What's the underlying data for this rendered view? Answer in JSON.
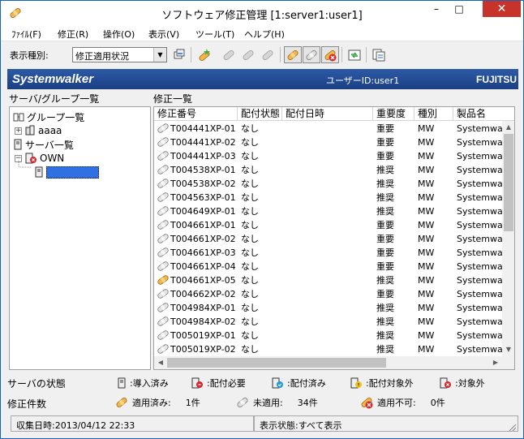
{
  "window": {
    "title": "ソフトウェア修正管理 [1:server1:user1]",
    "min": "–",
    "max": "□",
    "close": "✕"
  },
  "menu": [
    "ﾌｧｲﾙ(F)",
    "修正(R)",
    "操作(O)",
    "表示(V)",
    "ツール(T)",
    "ヘルプ(H)"
  ],
  "toolbar": {
    "label": "表示種別:",
    "select_value": "修正適用状況"
  },
  "banner": {
    "logo": "Systemwalker",
    "user": "ユーザーID:user1",
    "vendor": "FUJITSU"
  },
  "left_pane": {
    "heading": "サーバ/グループ一覧",
    "tree": [
      {
        "label": "グループ一覧"
      },
      {
        "label": "aaaa",
        "expander": "+"
      },
      {
        "label": "サーバ一覧"
      },
      {
        "label": "OWN",
        "expander": "−"
      },
      {
        "label": "███████"
      }
    ]
  },
  "right_pane": {
    "heading": "修正一覧",
    "columns": [
      "修正番号",
      "配付状態",
      "配付日時",
      "重要度",
      "種別",
      "製品名"
    ],
    "rows": [
      {
        "id": "T004441XP-01",
        "dist": "なし",
        "date": "",
        "severity": "重要",
        "kind": "MW",
        "product": "Systemwa",
        "status": "unapplied"
      },
      {
        "id": "T004441XP-02",
        "dist": "なし",
        "date": "",
        "severity": "重要",
        "kind": "MW",
        "product": "Systemwa",
        "status": "unapplied"
      },
      {
        "id": "T004441XP-03",
        "dist": "なし",
        "date": "",
        "severity": "重要",
        "kind": "MW",
        "product": "Systemwa",
        "status": "unapplied"
      },
      {
        "id": "T004538XP-01",
        "dist": "なし",
        "date": "",
        "severity": "推奨",
        "kind": "MW",
        "product": "Systemwa",
        "status": "unapplied"
      },
      {
        "id": "T004538XP-02",
        "dist": "なし",
        "date": "",
        "severity": "推奨",
        "kind": "MW",
        "product": "Systemwa",
        "status": "unapplied"
      },
      {
        "id": "T004563XP-01",
        "dist": "なし",
        "date": "",
        "severity": "推奨",
        "kind": "MW",
        "product": "Systemwa",
        "status": "unapplied"
      },
      {
        "id": "T004649XP-01",
        "dist": "なし",
        "date": "",
        "severity": "推奨",
        "kind": "MW",
        "product": "Systemwa",
        "status": "unapplied"
      },
      {
        "id": "T004661XP-01",
        "dist": "なし",
        "date": "",
        "severity": "重要",
        "kind": "MW",
        "product": "Systemwa",
        "status": "unapplied"
      },
      {
        "id": "T004661XP-02",
        "dist": "なし",
        "date": "",
        "severity": "重要",
        "kind": "MW",
        "product": "Systemwa",
        "status": "unapplied"
      },
      {
        "id": "T004661XP-03",
        "dist": "なし",
        "date": "",
        "severity": "重要",
        "kind": "MW",
        "product": "Systemwa",
        "status": "unapplied"
      },
      {
        "id": "T004661XP-04",
        "dist": "なし",
        "date": "",
        "severity": "重要",
        "kind": "MW",
        "product": "Systemwa",
        "status": "unapplied"
      },
      {
        "id": "T004661XP-05",
        "dist": "なし",
        "date": "",
        "severity": "推奨",
        "kind": "MW",
        "product": "Systemwa",
        "status": "applied"
      },
      {
        "id": "T004662XP-02",
        "dist": "なし",
        "date": "",
        "severity": "重要",
        "kind": "MW",
        "product": "Systemwa",
        "status": "unapplied"
      },
      {
        "id": "T004984XP-01",
        "dist": "なし",
        "date": "",
        "severity": "推奨",
        "kind": "MW",
        "product": "Systemwa",
        "status": "unapplied"
      },
      {
        "id": "T004984XP-02",
        "dist": "なし",
        "date": "",
        "severity": "推奨",
        "kind": "MW",
        "product": "Systemwa",
        "status": "unapplied"
      },
      {
        "id": "T005019XP-01",
        "dist": "なし",
        "date": "",
        "severity": "推奨",
        "kind": "MW",
        "product": "Systemwa",
        "status": "unapplied"
      },
      {
        "id": "T005019XP-02",
        "dist": "なし",
        "date": "",
        "severity": "推奨",
        "kind": "MW",
        "product": "Systemwa",
        "status": "unapplied"
      }
    ]
  },
  "legend": {
    "server_label": "サーバの状態",
    "server_items": [
      ":導入済み",
      ":配付必要",
      ":配付済み",
      ":配付対象外",
      ":対象外"
    ],
    "patch_label": "修正件数",
    "patch_items": [
      {
        "label": "適用済み:",
        "count": "1件"
      },
      {
        "label": "未適用:",
        "count": "34件"
      },
      {
        "label": "適用不可:",
        "count": "0件"
      }
    ]
  },
  "status_bar": {
    "collected": "収集日時:2013/04/12 22:33",
    "display": "表示状態:すべて表示"
  },
  "colors": {
    "banner": "#1b3f84",
    "selection": "#3070e0",
    "close_button": "#c7322a"
  }
}
